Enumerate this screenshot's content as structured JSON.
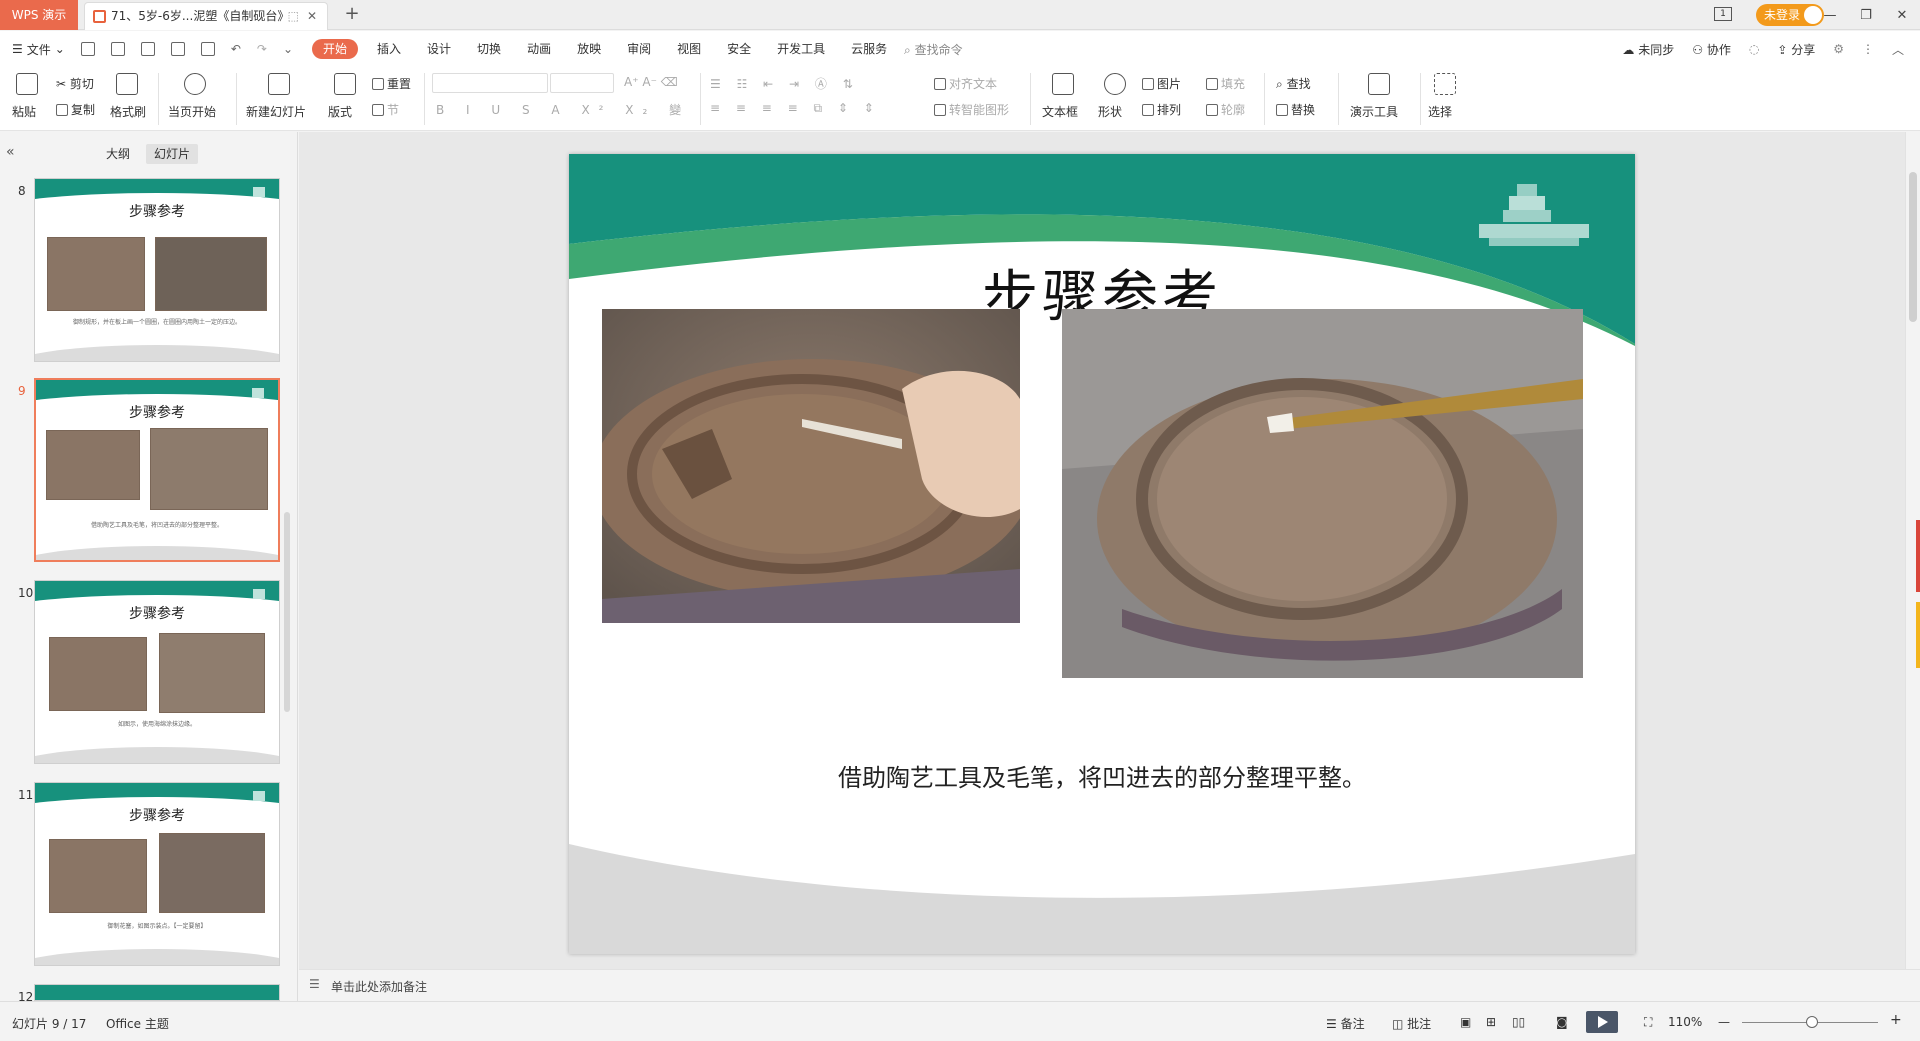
{
  "titlebar": {
    "app_name": "WPS 演示",
    "doc_tab_title": "71、5岁-6岁...泥塑《自制砚台》",
    "close_tab": "✕",
    "pin_tab": "⬚",
    "new_tab": "+",
    "login_label": "未登录",
    "layout_badge": "1",
    "minimize": "—",
    "restore": "❐",
    "close": "✕"
  },
  "menu": {
    "file": "文件",
    "tabs": [
      "开始",
      "插入",
      "设计",
      "切换",
      "动画",
      "放映",
      "审阅",
      "视图",
      "安全",
      "开发工具",
      "云服务"
    ],
    "active_tab": "开始",
    "search_cmd": "查找命令",
    "right": {
      "sync": "未同步",
      "collab": "协作",
      "share": "分享"
    }
  },
  "ribbon": {
    "paste": "粘贴",
    "cut": "剪切",
    "copy": "复制",
    "format_painter": "格式刷",
    "play_from_current": "当页开始",
    "new_slide": "新建幻灯片",
    "layout": "版式",
    "reset": "重置",
    "section": "节",
    "align_text": "对齐文本",
    "smartart": "转智能图形",
    "textbox": "文本框",
    "shape": "形状",
    "picture": "图片",
    "arrange": "排列",
    "fill": "填充",
    "outline": "轮廓",
    "find": "查找",
    "replace": "替换",
    "presenter_tools": "演示工具",
    "select": "选择"
  },
  "panel": {
    "outline_tab": "大纲",
    "slides_tab": "幻灯片",
    "collapse": "«",
    "thumbs": [
      {
        "num": "8",
        "title": "步骤参考",
        "caption": "御制规形，并在板上画一个圆圈，在圆圈内用陶土一定的压边。"
      },
      {
        "num": "9",
        "title": "步骤参考",
        "caption": "借助陶艺工具及毛笔，将凹进去的部分整理平整。"
      },
      {
        "num": "10",
        "title": "步骤参考",
        "caption": "如图示，使用海绵涂抹边缘。"
      },
      {
        "num": "11",
        "title": "步骤参考",
        "caption": "御制花塞，如图示装点。【一定要留】"
      },
      {
        "num": "12",
        "title": ""
      }
    ]
  },
  "slide": {
    "title": "步骤参考",
    "caption": "借助陶艺工具及毛笔，将凹进去的部分整理平整。"
  },
  "notes": {
    "placeholder": "单击此处添加备注"
  },
  "status": {
    "slide_counter": "幻灯片 9 / 17",
    "theme": "Office 主题",
    "notes_btn": "备注",
    "comments_btn": "批注",
    "zoom": "110%",
    "zoom_out": "—",
    "zoom_in": "+"
  },
  "colors": {
    "accent": "#ea6a4c",
    "slide_green": "#17917d",
    "slide_light_green": "#3ea872",
    "selected_border": "#ef7d5b"
  }
}
